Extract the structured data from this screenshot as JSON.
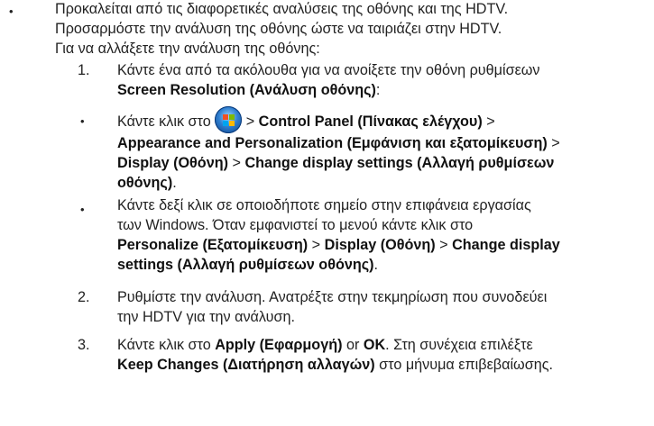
{
  "intro": {
    "bullet": "•",
    "line1": "Προκαλείται από τις διαφορετικές αναλύσεις της οθόνης και της HDTV.",
    "line2": "Προσαρμόστε την ανάλυση της οθόνης ώστε να ταιριάζει στην HDTV.",
    "line3": "Για να αλλάξετε την ανάλυση της οθόνης:"
  },
  "step1": {
    "number": "1.",
    "line1": "Κάντε ένα από τα ακόλουθα για να ανοίξετε την οθόνη ρυθμίσεων",
    "line2_bold": "Screen Resolution (Ανάλυση οθόνης)",
    "line2_tail": ":"
  },
  "sub1": {
    "bullet": "•",
    "pre": "Κάντε κλικ στο",
    "sep": ">",
    "control_panel": "Control Panel (Πίνακας ελέγχου)",
    "appearance": "Appearance and Personalization (Εμφάνιση και εξατομίκευση)",
    "display": "Display (Οθόνη)",
    "change_a": "Change display settings (Αλλαγή ρυθμίσεων",
    "change_b": "οθόνης)",
    "end": "."
  },
  "sub2": {
    "bullet": "•",
    "line1": "Κάντε δεξί κλικ σε οποιοδήποτε σημείο στην επιφάνεια εργασίας",
    "line2": "των Windows. Όταν εμφανιστεί το μενού κάντε κλικ στο",
    "personalize": "Personalize (Εξατομίκευση)",
    "sep": ">",
    "display": "Display (Οθόνη)",
    "change_a": "Change display",
    "change_b": "settings (Αλλαγή ρυθμίσεων οθόνης)",
    "end": "."
  },
  "step2": {
    "number": "2.",
    "line1": "Ρυθμίστε την ανάλυση. Ανατρέξτε στην τεκμηρίωση που συνοδεύει",
    "line2": "την HDTV για την ανάλυση."
  },
  "step3": {
    "number": "3.",
    "pre": "Κάντε κλικ στο",
    "apply": "Apply (Εφαρμογή)",
    "or": "or",
    "ok": "OK",
    "post": ". Στη συνέχεια επιλέξτε",
    "keep": "Keep Changes (Διατήρηση αλλαγών)",
    "end": "στο μήνυμα επιβεβαίωσης."
  },
  "icons": {
    "start": "windows-start-orb-icon"
  }
}
